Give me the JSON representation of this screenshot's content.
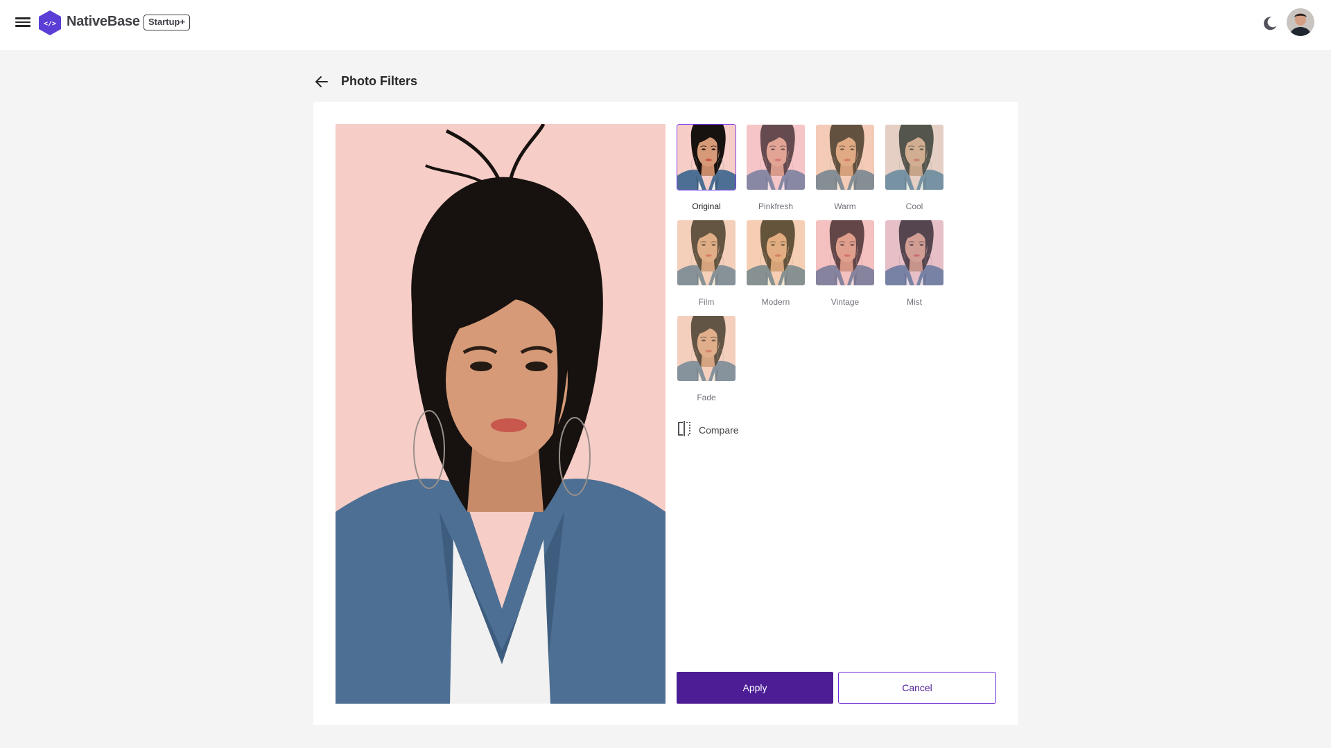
{
  "header": {
    "menu_icon": "hamburger-menu-icon",
    "brand_name": "NativeBase",
    "plan_badge": "Startup+",
    "theme_icon": "moon-icon"
  },
  "page": {
    "title": "Photo Filters",
    "back_icon": "arrow-left-icon"
  },
  "filters": [
    {
      "label": "Original",
      "selected": true,
      "tint": "#ffffff"
    },
    {
      "label": "Pinkfresh",
      "selected": false,
      "tint": "#f7b6c8"
    },
    {
      "label": "Warm",
      "selected": false,
      "tint": "#f1c89a"
    },
    {
      "label": "Cool",
      "selected": false,
      "tint": "#c6d4c0"
    },
    {
      "label": "Film",
      "selected": false,
      "tint": "#f0d3a4"
    },
    {
      "label": "Modern",
      "selected": false,
      "tint": "#f3d093"
    },
    {
      "label": "Vintage",
      "selected": false,
      "tint": "#f2a9b5"
    },
    {
      "label": "Mist",
      "selected": false,
      "tint": "#c9a6c9"
    },
    {
      "label": "Fade",
      "selected": false,
      "tint": "#f0d5b0"
    }
  ],
  "compare": {
    "label": "Compare",
    "icon": "compare-split-icon"
  },
  "actions": {
    "apply_label": "Apply",
    "cancel_label": "Cancel"
  },
  "colors": {
    "primary": "#4c1d95",
    "accent_border": "#6d28d9",
    "photo_background": "#f7c9c4"
  }
}
